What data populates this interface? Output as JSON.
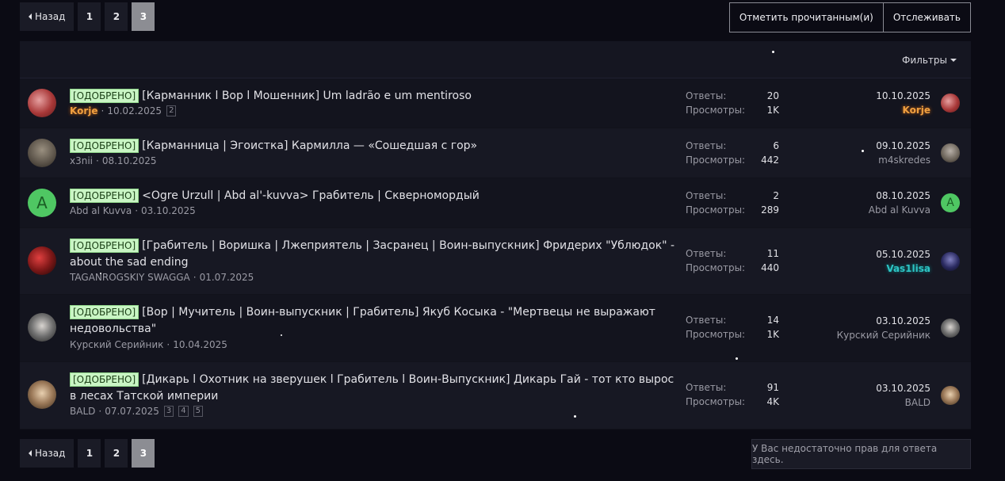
{
  "pagination": {
    "prev_label": "Назад",
    "pages": [
      "1",
      "2",
      "3"
    ],
    "current": "3"
  },
  "actions": {
    "mark_read": "Отметить прочитанным(и)",
    "watch": "Отслеживать"
  },
  "filters_label": "Фильтры",
  "labels": {
    "replies": "Ответы:",
    "views": "Просмотры:"
  },
  "threads": [
    {
      "prefix": "[ОДОБРЕНО]",
      "title": "[Карманник l Вор l Мошенник] Um ladrão e um mentiroso",
      "author": "Korje",
      "date": "10.02.2025",
      "pages": [
        "2"
      ],
      "replies": "20",
      "views": "1K",
      "last_date": "10.10.2025",
      "last_user": "Korje"
    },
    {
      "prefix": "[ОДОБРЕНО]",
      "title": "[Карманница | Эгоистка] Кармилла — «Сошедшая с гор»",
      "author": "x3nii",
      "date": "08.10.2025",
      "pages": [],
      "replies": "6",
      "views": "442",
      "last_date": "09.10.2025",
      "last_user": "m4skredes"
    },
    {
      "prefix": "[ОДОБРЕНО]",
      "title": "<Ogre Urzull | Abd al'-kuvva> Грабитель | Скверномордый",
      "author": "Abd al Kuvva",
      "date": "03.10.2025",
      "pages": [],
      "replies": "2",
      "views": "289",
      "last_date": "08.10.2025",
      "last_user": "Abd al Kuvva",
      "avatar_letter": "A"
    },
    {
      "prefix": "[ОДОБРЕНО]",
      "title": "[Грабитель | Воришка | Лжеприятель | Засранец | Воин-выпускник] Фридерих \"Ублюдок\" - about the sad ending",
      "author": "TAGANROGSKIY SWAGGA",
      "date": "01.07.2025",
      "pages": [],
      "replies": "11",
      "views": "440",
      "last_date": "05.10.2025",
      "last_user": "Vas1lisa"
    },
    {
      "prefix": "[ОДОБРЕНО]",
      "title": "[Вор | Мучитель | Воин-выпускник | Грабитель] Якуб Косыка - \"Мертвецы не выражают недовольства\"",
      "author": "Курский Серийник",
      "date": "10.04.2025",
      "pages": [],
      "replies": "14",
      "views": "1K",
      "last_date": "03.10.2025",
      "last_user": "Курский Серийник"
    },
    {
      "prefix": "[ОДОБРЕНО]",
      "title": "[Дикарь l Охотник на зверушек l Грабитель l Воин-Выпускник] Дикарь Гай - тот кто вырос в лесах Татской империи",
      "author": "BALD",
      "date": "07.07.2025",
      "pages": [
        "3",
        "4",
        "5"
      ],
      "replies": "91",
      "views": "4K",
      "last_date": "03.10.2025",
      "last_user": "BALD"
    }
  ],
  "no_permission": "У Вас недостаточно прав для ответа здесь.",
  "colors": {
    "background": "#0b0b14",
    "badge_bg": "#c9f5c4",
    "gold_user": "#f0a040",
    "teal_user": "#2ec4c4",
    "letter_avatar": "#4fc763"
  }
}
